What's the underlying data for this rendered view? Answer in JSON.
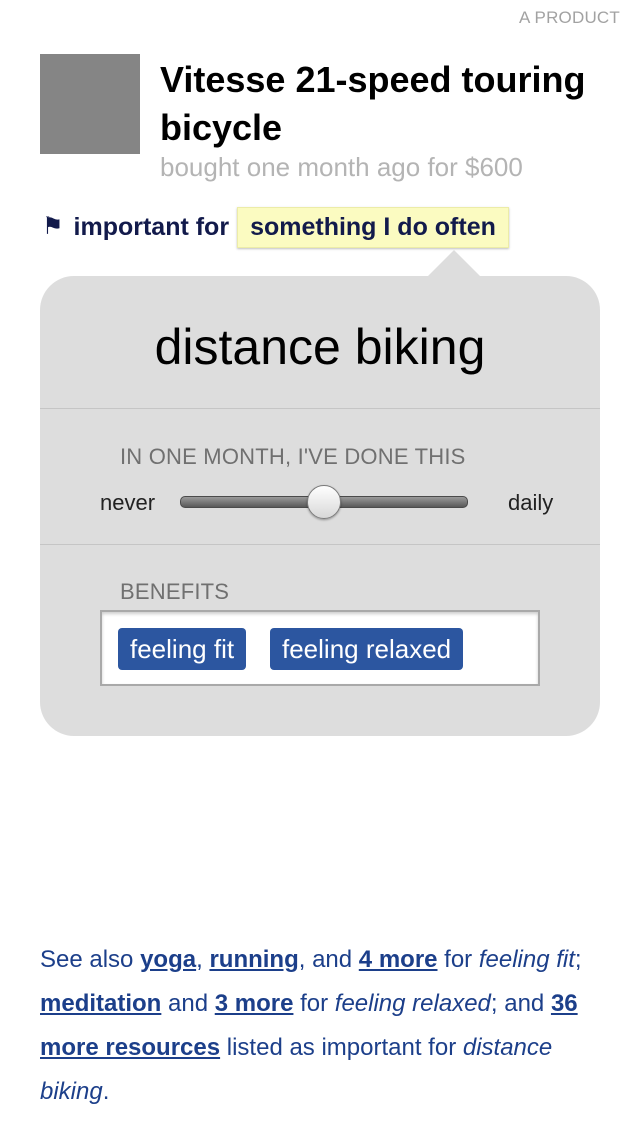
{
  "header": {
    "kicker": "A PRODUCT",
    "title": "Vitesse 21-speed touring bicycle",
    "subtitle": "bought one month ago for $600"
  },
  "importance": {
    "icon": "flag-icon",
    "label": "important for",
    "value": "something I do often",
    "highlight_color": "#fbfbc1"
  },
  "popover": {
    "activity": "distance biking",
    "frequency": {
      "label": "IN ONE MONTH, I'VE DONE THIS",
      "min_label": "never",
      "max_label": "daily",
      "value_fraction": 0.5
    },
    "benefits": {
      "label": "BENEFITS",
      "tags": [
        "feeling fit",
        "feeling relaxed"
      ],
      "tag_color": "#2c56a0"
    }
  },
  "see_also": {
    "t1": "See also ",
    "link_yoga": "yoga",
    "t2": ", ",
    "link_running": "running",
    "t3": ", and ",
    "link_4_more": "4 more",
    "t4": " for ",
    "em_fit": "feeling fit",
    "t5": "; ",
    "link_meditation": "meditation",
    "t6": " and ",
    "link_3_more": "3 more",
    "t7": " for ",
    "em_relaxed": "feeling relaxed",
    "t8": "; and ",
    "link_36_more": "36 more resources",
    "t9": " listed as important for ",
    "em_activity": "distance biking",
    "t10": ".",
    "text_color": "#1c3f8a"
  }
}
